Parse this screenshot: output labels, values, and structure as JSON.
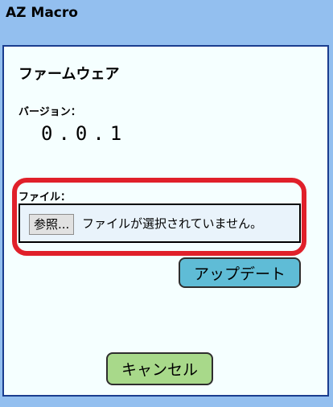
{
  "app": {
    "title": "AZ Macro"
  },
  "firmware": {
    "title": "ファームウェア",
    "version_label": "バージョン：",
    "version_value": "0.0.1",
    "file_label": "ファイル：",
    "browse_label": "参照...",
    "file_status": "ファイルが選択されていません。",
    "update_label": "アップデート",
    "cancel_label": "キャンセル"
  },
  "colors": {
    "background": "#93bfef",
    "panel": "#f5ffff",
    "panel_border": "#1a3d8f",
    "highlight": "#e0202a",
    "update_button": "#5fbcd6",
    "cancel_button": "#a8d98a"
  }
}
